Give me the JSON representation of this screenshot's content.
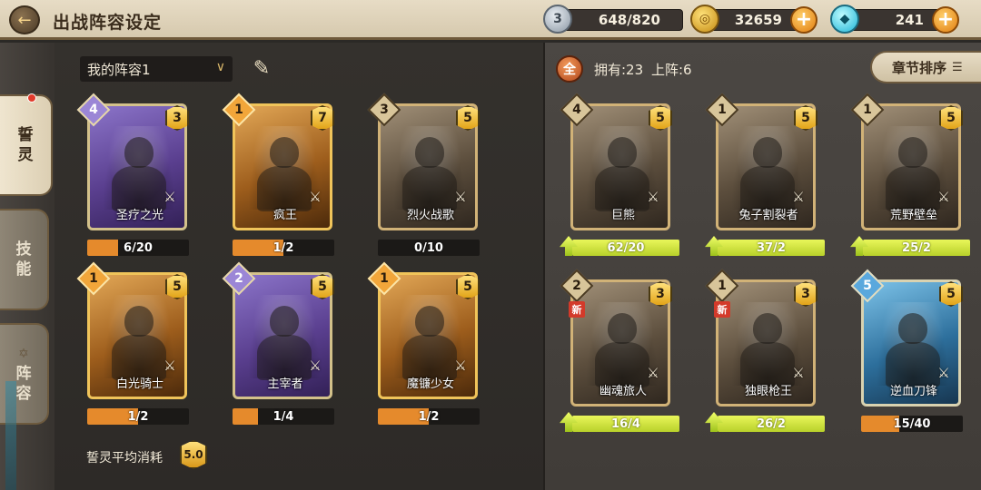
{
  "header": {
    "title": "出战阵容设定",
    "back_icon": "back-arrow-icon"
  },
  "resources": {
    "stamina": {
      "level": "3",
      "value": "648/820"
    },
    "gold": {
      "value": "32659"
    },
    "gems": {
      "value": "241"
    },
    "plus": "+"
  },
  "side_tabs": [
    {
      "label_1": "誓",
      "label_2": "灵",
      "active": true
    },
    {
      "label_1": "技",
      "label_2": "能",
      "active": false
    },
    {
      "label_1": "阵",
      "label_2": "容",
      "active": false
    }
  ],
  "lineup": {
    "selector": "我的阵容1",
    "avg_cost_label": "誓灵平均消耗",
    "avg_cost": "5.0",
    "cards": [
      {
        "name": "圣疗之光",
        "cost": "4",
        "stars": "3",
        "rarity": "purple",
        "progress": "6/20",
        "ratio": 0.3
      },
      {
        "name": "疯王",
        "cost": "1",
        "stars": "7",
        "rarity": "orange",
        "progress": "1/2",
        "ratio": 0.5
      },
      {
        "name": "烈火战歌",
        "cost": "3",
        "stars": "5",
        "rarity": "bronze",
        "progress": "0/10",
        "ratio": 0.0
      },
      {
        "name": "白光骑士",
        "cost": "1",
        "stars": "5",
        "rarity": "orange",
        "progress": "1/2",
        "ratio": 0.5
      },
      {
        "name": "主宰者",
        "cost": "2",
        "stars": "5",
        "rarity": "purple",
        "progress": "1/4",
        "ratio": 0.25
      },
      {
        "name": "魔镰少女",
        "cost": "1",
        "stars": "5",
        "rarity": "orange",
        "progress": "1/2",
        "ratio": 0.5
      }
    ]
  },
  "collection": {
    "filter": "全",
    "owned_text": "拥有:23",
    "deployed_text": "上阵:6",
    "sort_label": "章节排序",
    "new_label": "新",
    "cards": [
      {
        "name": "巨熊",
        "cost": "4",
        "stars": "5",
        "rarity": "bronze",
        "progress": "62/20",
        "upgradable": true,
        "ratio": 1.0,
        "is_new": false
      },
      {
        "name": "兔子割裂者",
        "cost": "1",
        "stars": "5",
        "rarity": "bronze",
        "progress": "37/2",
        "upgradable": true,
        "ratio": 1.0,
        "is_new": false
      },
      {
        "name": "荒野壁垒",
        "cost": "1",
        "stars": "5",
        "rarity": "bronze",
        "progress": "25/2",
        "upgradable": true,
        "ratio": 1.0,
        "is_new": false
      },
      {
        "name": "幽魂旅人",
        "cost": "2",
        "stars": "3",
        "rarity": "bronze",
        "progress": "16/4",
        "upgradable": true,
        "ratio": 1.0,
        "is_new": true
      },
      {
        "name": "独眼枪王",
        "cost": "1",
        "stars": "3",
        "rarity": "bronze",
        "progress": "26/2",
        "upgradable": true,
        "ratio": 1.0,
        "is_new": true
      },
      {
        "name": "逆血刀锋",
        "cost": "5",
        "stars": "5",
        "rarity": "blue",
        "progress": "15/40",
        "upgradable": false,
        "ratio": 0.375,
        "is_new": false
      }
    ]
  }
}
